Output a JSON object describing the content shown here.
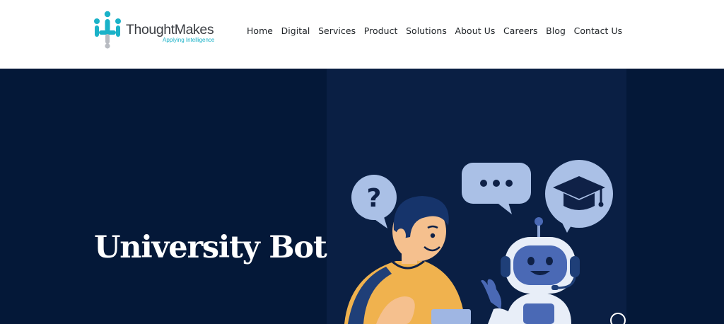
{
  "brand": {
    "name": "ThoughtMakes",
    "tagline": "Applying Intelligence",
    "colors": {
      "teal": "#1ab2c8",
      "gray": "#b9bcc2"
    }
  },
  "nav": {
    "items": [
      {
        "label": "Home"
      },
      {
        "label": "Digital"
      },
      {
        "label": "Services"
      },
      {
        "label": "Product"
      },
      {
        "label": "Solutions"
      },
      {
        "label": "About Us"
      },
      {
        "label": "Careers"
      },
      {
        "label": "Blog"
      },
      {
        "label": "Contact Us"
      }
    ]
  },
  "hero": {
    "title": "University Bot",
    "background": "#041838",
    "illustration": {
      "icons": [
        "question-bubble-icon",
        "typing-bubble-icon",
        "graduation-cap-bubble-icon"
      ]
    }
  }
}
